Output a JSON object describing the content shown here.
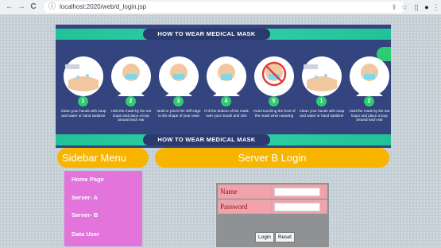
{
  "browser": {
    "url": "localhost:2020/web/d_login.jsp",
    "back_glyph": "←",
    "forward_glyph": "→",
    "reload_glyph": "C",
    "info_glyph": "ⓘ",
    "share_glyph": "⇪",
    "star_glyph": "☆",
    "sidebar_glyph": "▯",
    "profile_glyph": "●",
    "menu_glyph": "⋮"
  },
  "banner": {
    "heading_top": "HOW TO WEAR MEDICAL MASK",
    "heading_bottom": "HOW TO WEAR MEDICAL MASK",
    "accent_color": "#2ecc71",
    "steps": [
      {
        "number": "1",
        "caption": "Clean your hands with soap and water or hand sanitizer"
      },
      {
        "number": "2",
        "caption": "Hold the mask by the ear loops and place a loop around each ear"
      },
      {
        "number": "3",
        "caption": "Mold or pinch the stiff edge to the shape of your nose"
      },
      {
        "number": "4",
        "caption": "Pull the bottom of the mask over your mouth and chin"
      },
      {
        "number": "5",
        "caption": "Avoid touching the front of the mask when wearing"
      },
      {
        "number": "1",
        "caption": "Clean your hands with soap and water or hand sanitizer"
      },
      {
        "number": "2",
        "caption": "Hold the mask by the ear loops and place a loop around each ear"
      }
    ]
  },
  "sidebar": {
    "title": "Sidebar Menu",
    "items": [
      {
        "label": "Home Page"
      },
      {
        "label": "Server- A"
      },
      {
        "label": "Server- B"
      },
      {
        "label": "Data User"
      }
    ]
  },
  "main": {
    "title": "Server B Login"
  },
  "login_form": {
    "name_label": "Name",
    "name_value": "",
    "password_label": "Password",
    "password_value": "",
    "login_button": "Login",
    "reset_button": "Reset"
  }
}
